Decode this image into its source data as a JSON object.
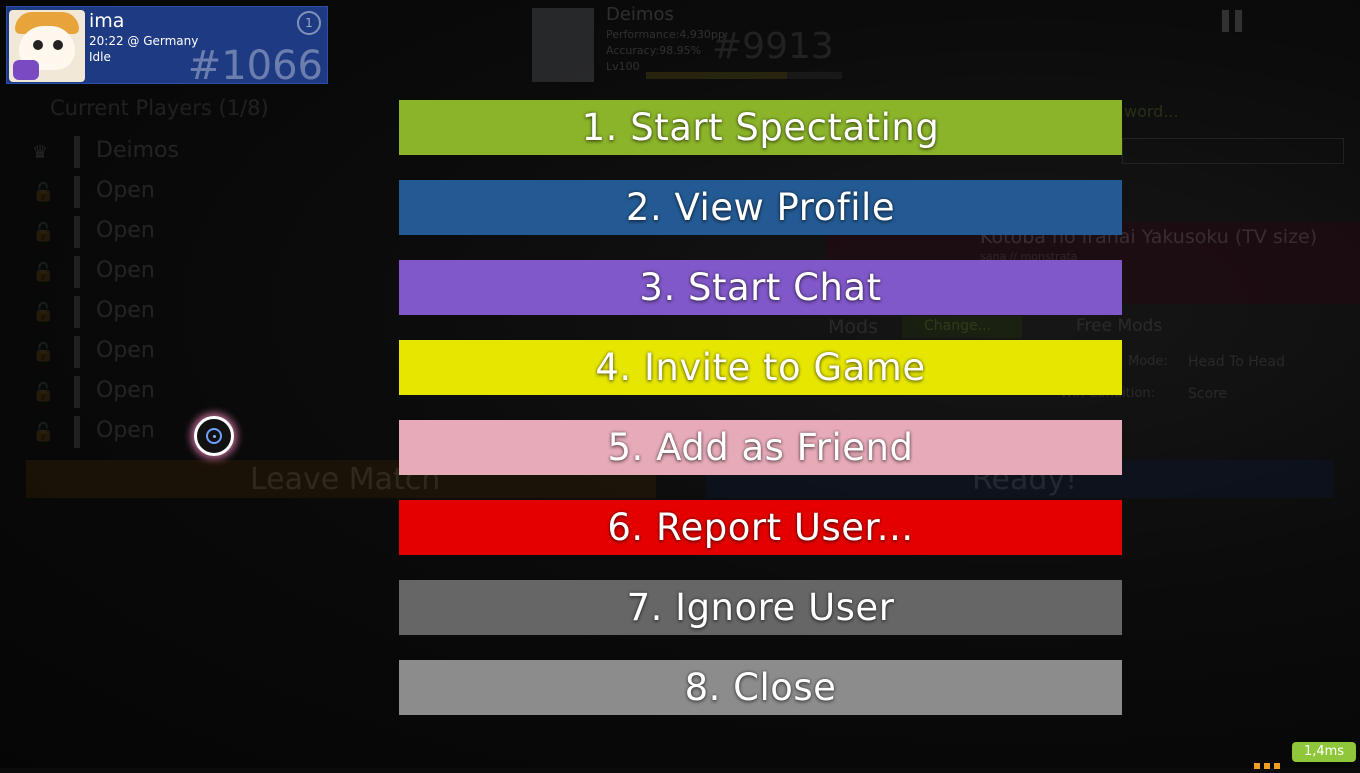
{
  "colors": {
    "spectate": "#8bb42a",
    "profile": "#245a93",
    "chat": "#8158c9",
    "invite": "#e6e600",
    "friend": "#e6aab8",
    "report": "#e40000",
    "ignore": "#666666",
    "close": "#8c8c8c"
  },
  "user_card": {
    "name": "ima",
    "time_location": "20:22 @ Germany",
    "status": "Idle",
    "rank": "#1066",
    "mode_icon": "1"
  },
  "background": {
    "opponent": {
      "name": "Deimos",
      "performance": "Performance:4,930pp",
      "accuracy": "Accuracy:98.95%",
      "level": "Lv100",
      "rank": "#9913"
    },
    "players_header": "Current Players (1/8)",
    "slots": [
      "Deimos",
      "Open",
      "Open",
      "Open",
      "Open",
      "Open",
      "Open",
      "Open"
    ],
    "leave_label": "Leave Match",
    "ready_label": "Ready!",
    "password_hint": "word...",
    "song_title": "Kotoba no Iranai Yakusoku (TV size)",
    "song_artist": "sana // monstrata",
    "mods_label": "Mods",
    "change_label": "Change...",
    "free_mods_label": "Free Mods",
    "team_mode_label": "Mode:",
    "team_mode_value": "Head To Head",
    "win_condition_label": "Win Condition:",
    "win_condition_value": "Score"
  },
  "menu": [
    {
      "label": "1. Start Spectating",
      "color_key": "spectate",
      "name": "start-spectating-button"
    },
    {
      "label": "2. View Profile",
      "color_key": "profile",
      "name": "view-profile-button"
    },
    {
      "label": "3. Start Chat",
      "color_key": "chat",
      "name": "start-chat-button"
    },
    {
      "label": "4. Invite to Game",
      "color_key": "invite",
      "name": "invite-to-game-button"
    },
    {
      "label": "5. Add as Friend",
      "color_key": "friend",
      "name": "add-as-friend-button"
    },
    {
      "label": "6. Report User...",
      "color_key": "report",
      "name": "report-user-button"
    },
    {
      "label": "7. Ignore User",
      "color_key": "ignore",
      "name": "ignore-user-button"
    },
    {
      "label": "8. Close",
      "color_key": "close",
      "name": "close-button"
    }
  ],
  "latency": "1,4ms"
}
